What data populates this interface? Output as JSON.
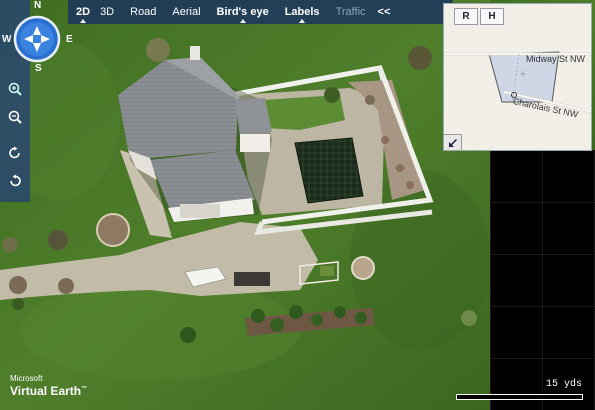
{
  "compass": {
    "n": "N",
    "s": "S",
    "e": "E",
    "w": "W"
  },
  "toolbar": {
    "items": [
      {
        "label": "2D",
        "bold": true,
        "selected": true
      },
      {
        "label": "3D"
      },
      {
        "label": "Road"
      },
      {
        "label": "Aerial"
      },
      {
        "label": "Bird's eye",
        "bold": true,
        "selected": true
      },
      {
        "label": "Labels",
        "bold": true,
        "selected": true
      },
      {
        "label": "Traffic",
        "dim": true
      }
    ],
    "collapse": "<<"
  },
  "minimap": {
    "tabs": [
      "R",
      "H"
    ],
    "streets": [
      "Midway St NW",
      "Charolais St NW"
    ]
  },
  "logo": {
    "company": "Microsoft",
    "product": "Virtual Earth",
    "tm": "™"
  },
  "scale": {
    "label": "15 yds"
  },
  "colors": {
    "grass": "#4d7a2a",
    "panel": "#1e375f",
    "accent": "#2a6fd0"
  }
}
